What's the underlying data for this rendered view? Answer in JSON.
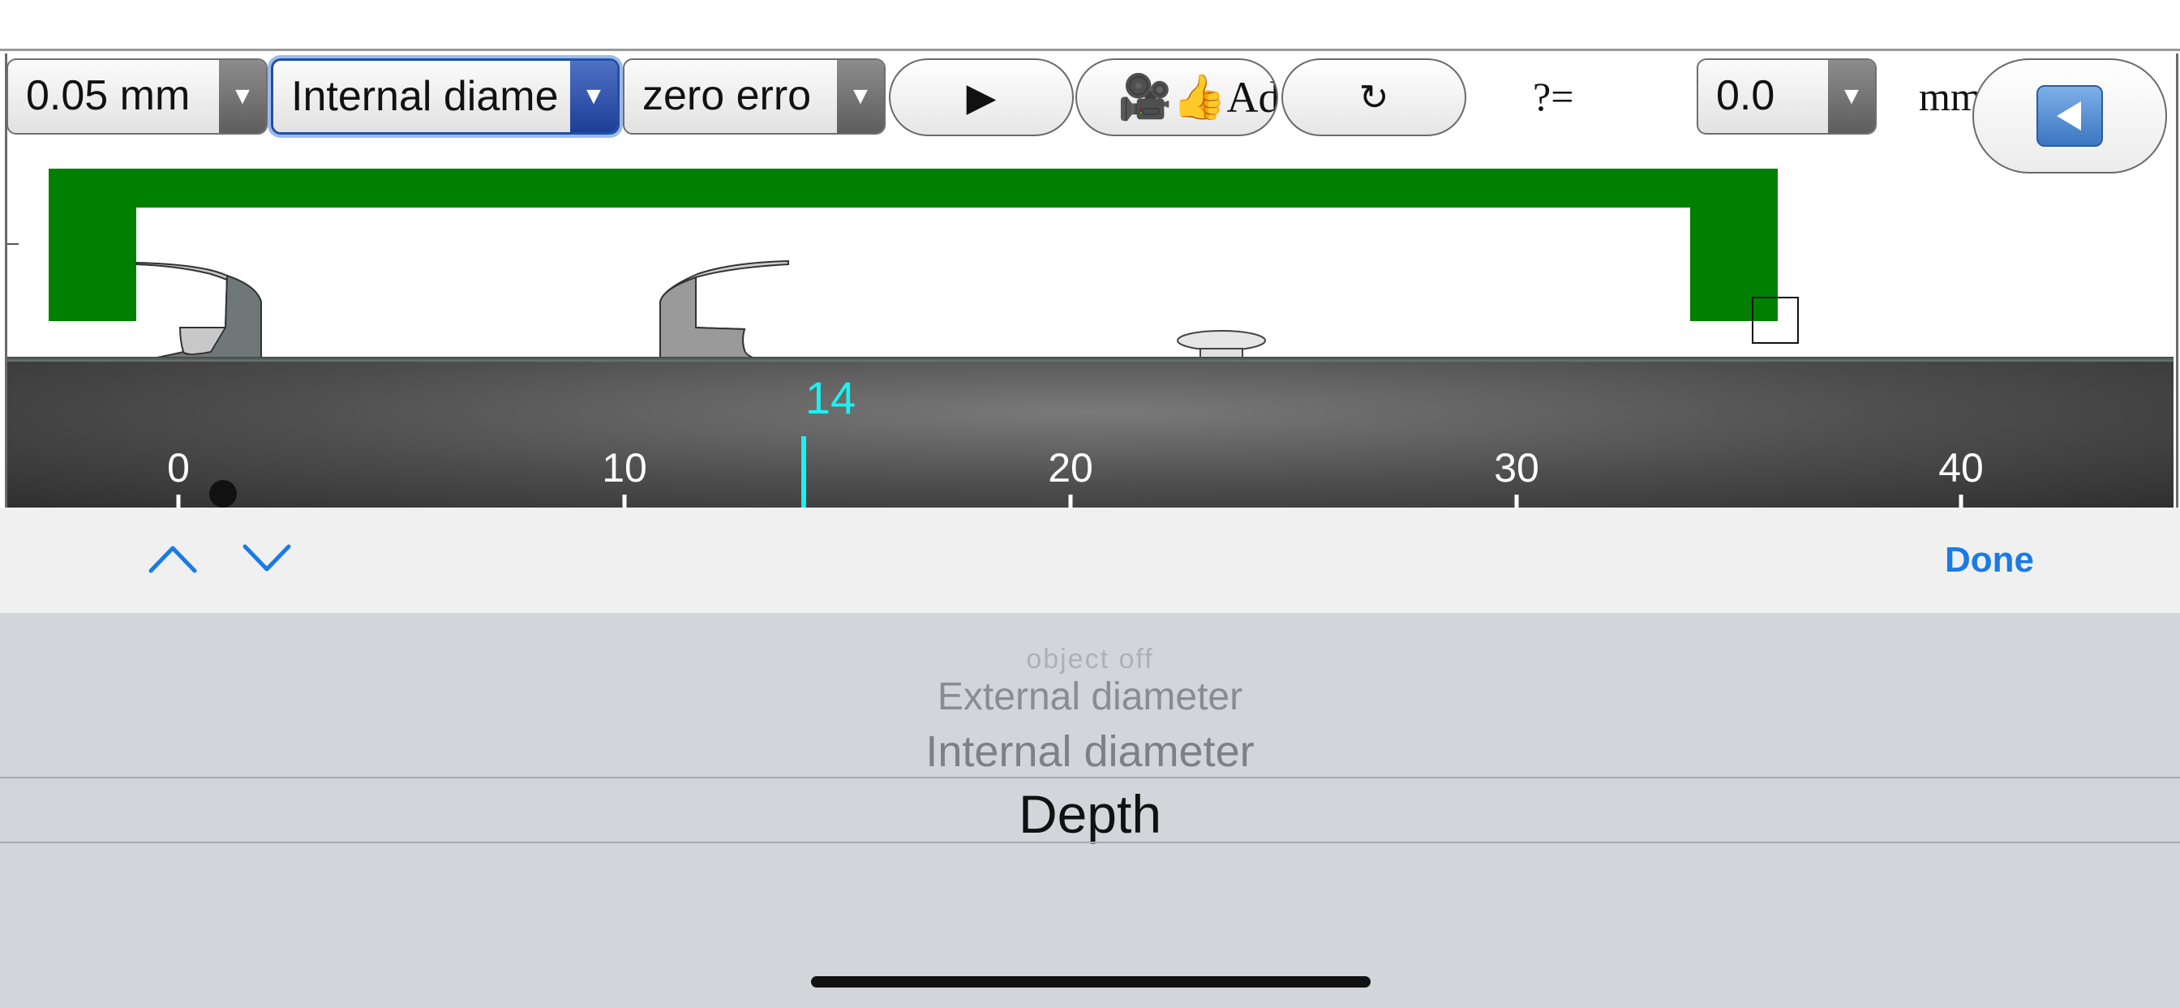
{
  "toolbar": {
    "precision_select": {
      "value": "0.05 mm"
    },
    "mode_select": {
      "value": "Internal diame"
    },
    "zero_select": {
      "value": "zero erro"
    },
    "play_label": "▶",
    "ad_label": "🎥👍Ad",
    "refresh_label": "↻",
    "answer_prompt": "?=",
    "answer_select": {
      "value": "0.0"
    },
    "unit_label": "mm"
  },
  "caliper": {
    "main_scale_ticks": [
      "0",
      "10",
      "20",
      "30",
      "40"
    ],
    "cursor_value": "14",
    "jaw_color": "#008000",
    "cursor_color": "#1cf0f0"
  },
  "accessory_bar": {
    "prev_icon": "chevron-up-icon",
    "next_icon": "chevron-down-icon",
    "done_label": "Done",
    "accent": "#1a7ae6"
  },
  "picker": {
    "options": [
      "object off",
      "External diameter",
      "Internal diameter",
      "Depth"
    ],
    "selected": "Depth"
  }
}
